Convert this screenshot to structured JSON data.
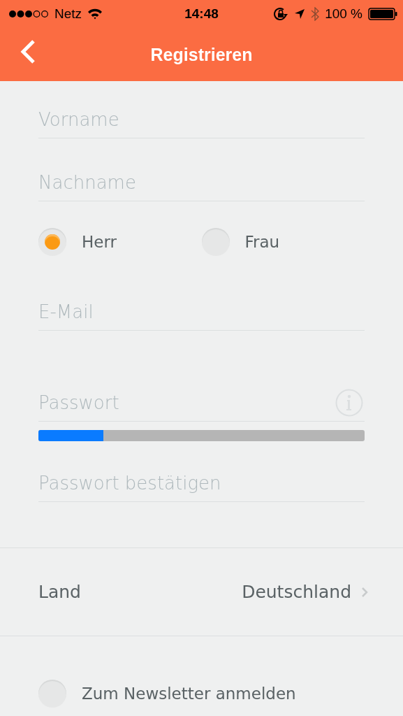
{
  "status_bar": {
    "carrier": "Netz",
    "time": "14:48",
    "battery": "100 %"
  },
  "nav": {
    "title": "Registrieren"
  },
  "name_fields": [
    {
      "placeholder": "Vorname"
    },
    {
      "placeholder": "Nachname"
    }
  ],
  "salutation": [
    {
      "label": "Herr",
      "selected": true
    },
    {
      "label": "Frau",
      "selected": false
    }
  ],
  "email": {
    "placeholder": "E-Mail"
  },
  "password": {
    "placeholder": "Passwort",
    "level": 0.2
  },
  "confirm": {
    "placeholder": "Passwort bestätigen"
  },
  "country": {
    "label": "Land",
    "value": "Deutschland"
  },
  "newsletter": {
    "label": "Zum Newsletter anmelden",
    "checked": false
  }
}
